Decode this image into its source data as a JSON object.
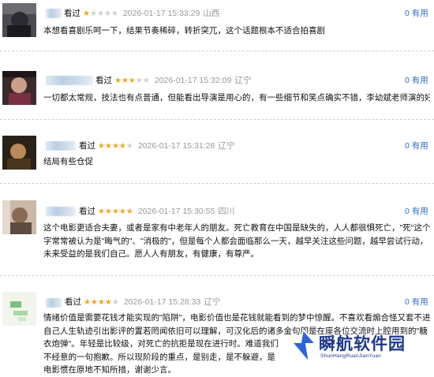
{
  "reviews": [
    {
      "status": "看过",
      "rating": 1,
      "time": "2026-01-17 15:33:29",
      "location": "山西",
      "useful_count": "0",
      "useful_label": "有用",
      "lines": [
        "本想看喜剧乐呵一下，结果节奏稀碎，转折突兀，这个话题根本不适合拍喜剧"
      ]
    },
    {
      "status": "看过",
      "rating": 3,
      "time": "2026-01-17 15:32:09",
      "location": "辽宁",
      "useful_count": "0",
      "useful_label": "有用",
      "lines": [
        "一切都太常规，技法也有点普通，但能看出导演是用心的，有一些细节和笑点确实不错，李幼斌老师演的好"
      ]
    },
    {
      "status": "看过",
      "rating": 4,
      "time": "2026-01-17 15:31:28",
      "location": "辽宁",
      "useful_count": "0",
      "useful_label": "有用",
      "lines": [
        "结局有些仓促"
      ]
    },
    {
      "status": "看过",
      "rating": 5,
      "time": "2026-01-17 15:30:55",
      "location": "四川",
      "useful_count": "0",
      "useful_label": "有用",
      "lines": [
        "这个电影更适合夫妻，或者是家有中老年人的朋友。死亡教育在中国是缺失的，人人都很惧死亡，\"死\"这个",
        "字常常被认为是\"晦气的\"、\"消极的\"，但是每个人都会面临那么一天，越早关注这些问题，越早尝试行动，",
        "未来受益的是我们自己。愿人人有朋友，有健康，有尊严。"
      ]
    },
    {
      "status": "看过",
      "rating": 4,
      "time": "2026-01-17 15:28:33",
      "location": "辽宁",
      "useful_count": "0",
      "useful_label": "有用",
      "lines": [
        "情绪价值是需要花钱才能实现的\"陷阱\"，电影价值也是花钱就能看到的梦中惊醒。不喜欢看煽合怪又套不进",
        "自己人生轨迹引出影评的置若罔闻依旧可以理解，可汉化后的诸多金句即是在座各位交流时上腔用到的\"糖",
        "衣炮弹\"。年轻是比较级，对死亡的抗拒是现在进行时。难道我们",
        "不经意的一句抱歉。所以现阶段的重点，是别走，是不躲避，是",
        "电影惯在原地不知所措，谢谢少言。"
      ]
    }
  ],
  "watermark": {
    "title": "瞬航软件园",
    "subtitle": "ShunHangRuanJianYuan"
  }
}
